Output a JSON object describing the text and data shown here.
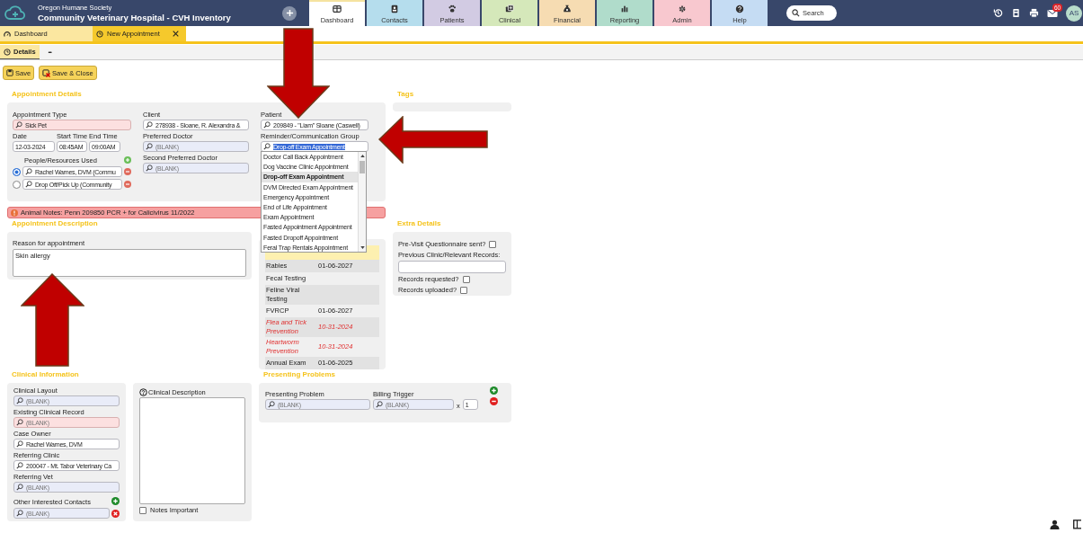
{
  "header": {
    "organization": "Oregon Humane Society",
    "title": "Community Veterinary Hospital - CVH Inventory",
    "nav": [
      {
        "label": "Dashboard",
        "selected": true,
        "color": "#ffffff"
      },
      {
        "label": "Contacts",
        "selected": false,
        "color": "#b5dded"
      },
      {
        "label": "Patients",
        "selected": false,
        "color": "#d2cbe3"
      },
      {
        "label": "Clinical",
        "selected": false,
        "color": "#d5e8ba"
      },
      {
        "label": "Financial",
        "selected": false,
        "color": "#f6dcb2"
      },
      {
        "label": "Reporting",
        "selected": false,
        "color": "#b0dccb"
      },
      {
        "label": "Admin",
        "selected": false,
        "color": "#f8c8cf"
      },
      {
        "label": "Help",
        "selected": false,
        "color": "#c5dcf3"
      }
    ],
    "search": {
      "placeholder": "Search"
    },
    "mail_count": "60",
    "avatar": "AS"
  },
  "doc_tabs": [
    {
      "label": "Dashboard",
      "selected": false,
      "closable": false
    },
    {
      "label": "New Appointment",
      "selected": true,
      "closable": true
    }
  ],
  "sub_tabs": [
    {
      "label": "Details",
      "selected": true
    }
  ],
  "more": "•••",
  "toolbar": [
    {
      "label": "Save"
    },
    {
      "label": "Save & Close"
    }
  ],
  "appointment_details": {
    "heading": "Appointment Details",
    "appointment_type": {
      "label": "Appointment Type",
      "value": "Sick Pet",
      "required": true
    },
    "date": {
      "label": "Date",
      "value": "12-03-2024"
    },
    "start_time": {
      "label": "Start Time",
      "value": "08:45AM"
    },
    "end_time": {
      "label": "End Time",
      "value": "09:00AM"
    },
    "resources": {
      "label": "People/Resources Used",
      "items": [
        {
          "value": "Rachel Warnes, DVM (Commu",
          "selected": true
        },
        {
          "value": "Drop Off/Pick Up (Community",
          "selected": false
        }
      ]
    },
    "client": {
      "label": "Client",
      "value": "278938 -  Sloane, R. Alexandra &"
    },
    "preferred_doctor": {
      "label": "Preferred Doctor",
      "placeholder": "(BLANK)"
    },
    "second_preferred_doctor": {
      "label": "Second Preferred Doctor",
      "placeholder": "(BLANK)"
    },
    "patient": {
      "label": "Patient",
      "value": "209849 - \"Liam\" Sloane (Caswell)"
    },
    "reminder_group": {
      "label": "Reminder/Communication Group",
      "value": "Drop-off Exam Appointment",
      "options": [
        {
          "label": "Doctor Call Back Appointment",
          "selected": false
        },
        {
          "label": "Dog Vaccine Clinic Appointment",
          "selected": false
        },
        {
          "label": "Drop-off Exam Appointment",
          "selected": true
        },
        {
          "label": "DVM Directed Exam Appointment",
          "selected": false
        },
        {
          "label": "Emergency Appointment",
          "selected": false
        },
        {
          "label": "End of Life Appointment",
          "selected": false
        },
        {
          "label": "Exam Appointment",
          "selected": false
        },
        {
          "label": "Fasted Appointment Appointment",
          "selected": false
        },
        {
          "label": "Fasted Dropoff Appointment",
          "selected": false
        },
        {
          "label": "Feral Trap Rentals Appointment",
          "selected": false
        }
      ]
    }
  },
  "tags": {
    "heading": "Tags"
  },
  "animal_notes": "Animal Notes: Penn 209850 PCR + for Calicivirus 11/2022",
  "appointment_description": {
    "heading": "Appointment Description",
    "label": "Reason for appointment",
    "value": "Skin allergy"
  },
  "vaccines": [
    {
      "name": "Rabies",
      "date": "01-06-2027",
      "overdue": false
    },
    {
      "name": "Fecal Testing",
      "overdue": false
    },
    {
      "name": "Feline Viral Testing",
      "overdue": false
    },
    {
      "name": "FVRCP",
      "date": "01-06-2027",
      "overdue": false
    },
    {
      "name": "Flea and Tick Prevention",
      "date": "10-31-2024",
      "overdue": true
    },
    {
      "name": "Heartworm Prevention",
      "date": "10-31-2024",
      "overdue": true
    },
    {
      "name": "Annual Exam",
      "date": "01-06-2025",
      "overdue": false
    }
  ],
  "extra_details": {
    "heading": "Extra Details",
    "items": [
      {
        "kind": "checkbox",
        "label": "Pre-Visit Questionnaire sent?",
        "checked": false
      },
      {
        "kind": "text",
        "label": "Previous Clinic/Relevant Records:"
      },
      {
        "kind": "checkbox",
        "label": "Records requested?",
        "checked": false
      },
      {
        "kind": "checkbox",
        "label": "Records uploaded?",
        "checked": false
      }
    ]
  },
  "clinical_information": {
    "heading": "Clinical Information",
    "fields": [
      {
        "label": "Clinical Layout",
        "placeholder": "(BLANK)",
        "required": false
      },
      {
        "label": "Existing Clinical Record",
        "placeholder": "(BLANK)",
        "required": true
      },
      {
        "label": "Case Owner",
        "value": "Rachel Warnes, DVM",
        "required": false
      },
      {
        "label": "Referring Clinic",
        "value": "200047 - Mt. Tabor Veterinary Ca",
        "required": false
      },
      {
        "label": "Referring Vet",
        "placeholder": "(BLANK)",
        "required": false
      }
    ],
    "contacts": {
      "label": "Other Interested Contacts",
      "placeholder": "(BLANK)"
    }
  },
  "clinical_description": {
    "label": "Clinical Description",
    "notes_important": {
      "label": "Notes Important",
      "checked": false
    }
  },
  "presenting_problems": {
    "heading": "Presenting Problems",
    "problem": {
      "label": "Presenting Problem",
      "placeholder": "(BLANK)"
    },
    "billing": {
      "label": "Billing Trigger",
      "placeholder": "(BLANK)"
    },
    "times": "x",
    "quantity": "1"
  }
}
